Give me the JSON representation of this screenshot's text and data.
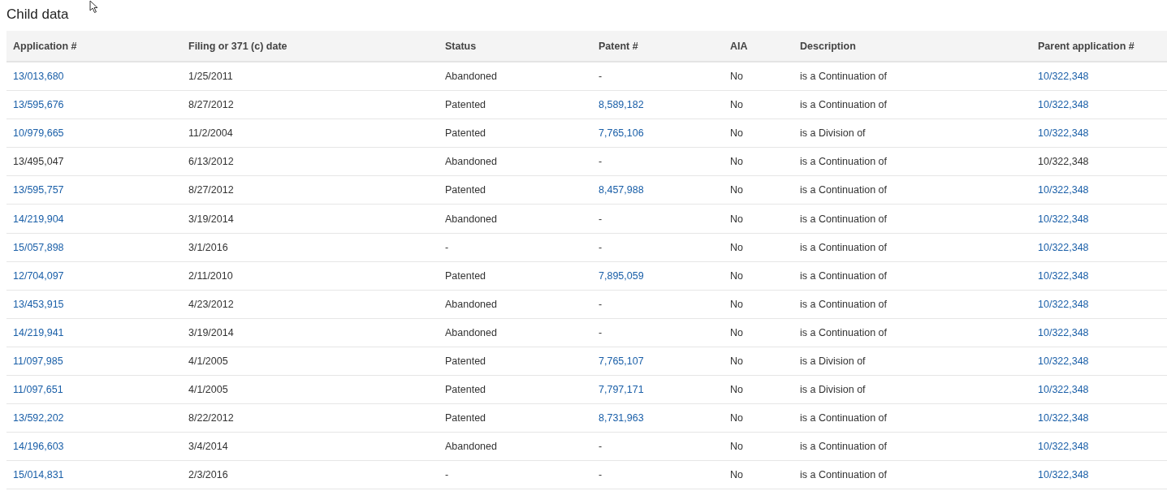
{
  "title": "Child data",
  "table": {
    "columns": [
      "Application #",
      "Filing or 371 (c) date",
      "Status",
      "Patent #",
      "AIA",
      "Description",
      "Parent application #"
    ],
    "rows": [
      {
        "application": "13/013,680",
        "date": "1/25/2011",
        "status": "Abandoned",
        "patent": "-",
        "patent_linked": false,
        "aia": "No",
        "description": "is a Continuation of",
        "parent": "10/322,348",
        "linked": true
      },
      {
        "application": "13/595,676",
        "date": "8/27/2012",
        "status": "Patented",
        "patent": "8,589,182",
        "patent_linked": true,
        "aia": "No",
        "description": "is a Continuation of",
        "parent": "10/322,348",
        "linked": true
      },
      {
        "application": "10/979,665",
        "date": "11/2/2004",
        "status": "Patented",
        "patent": "7,765,106",
        "patent_linked": true,
        "aia": "No",
        "description": "is a Division of",
        "parent": "10/322,348",
        "linked": true
      },
      {
        "application": "13/495,047",
        "date": "6/13/2012",
        "status": "Abandoned",
        "patent": "-",
        "patent_linked": false,
        "aia": "No",
        "description": "is a Continuation of",
        "parent": "10/322,348",
        "linked": false
      },
      {
        "application": "13/595,757",
        "date": "8/27/2012",
        "status": "Patented",
        "patent": "8,457,988",
        "patent_linked": true,
        "aia": "No",
        "description": "is a Continuation of",
        "parent": "10/322,348",
        "linked": true
      },
      {
        "application": "14/219,904",
        "date": "3/19/2014",
        "status": "Abandoned",
        "patent": "-",
        "patent_linked": false,
        "aia": "No",
        "description": "is a Continuation of",
        "parent": "10/322,348",
        "linked": true
      },
      {
        "application": "15/057,898",
        "date": "3/1/2016",
        "status": "-",
        "patent": "-",
        "patent_linked": false,
        "aia": "No",
        "description": "is a Continuation of",
        "parent": "10/322,348",
        "linked": true
      },
      {
        "application": "12/704,097",
        "date": "2/11/2010",
        "status": "Patented",
        "patent": "7,895,059",
        "patent_linked": true,
        "aia": "No",
        "description": "is a Continuation of",
        "parent": "10/322,348",
        "linked": true
      },
      {
        "application": "13/453,915",
        "date": "4/23/2012",
        "status": "Abandoned",
        "patent": "-",
        "patent_linked": false,
        "aia": "No",
        "description": "is a Continuation of",
        "parent": "10/322,348",
        "linked": true
      },
      {
        "application": "14/219,941",
        "date": "3/19/2014",
        "status": "Abandoned",
        "patent": "-",
        "patent_linked": false,
        "aia": "No",
        "description": "is a Continuation of",
        "parent": "10/322,348",
        "linked": true
      },
      {
        "application": "11/097,985",
        "date": "4/1/2005",
        "status": "Patented",
        "patent": "7,765,107",
        "patent_linked": true,
        "aia": "No",
        "description": "is a Division of",
        "parent": "10/322,348",
        "linked": true
      },
      {
        "application": "11/097,651",
        "date": "4/1/2005",
        "status": "Patented",
        "patent": "7,797,171",
        "patent_linked": true,
        "aia": "No",
        "description": "is a Division of",
        "parent": "10/322,348",
        "linked": true
      },
      {
        "application": "13/592,202",
        "date": "8/22/2012",
        "status": "Patented",
        "patent": "8,731,963",
        "patent_linked": true,
        "aia": "No",
        "description": "is a Continuation of",
        "parent": "10/322,348",
        "linked": true
      },
      {
        "application": "14/196,603",
        "date": "3/4/2014",
        "status": "Abandoned",
        "patent": "-",
        "patent_linked": false,
        "aia": "No",
        "description": "is a Continuation of",
        "parent": "10/322,348",
        "linked": true
      },
      {
        "application": "15/014,831",
        "date": "2/3/2016",
        "status": "-",
        "patent": "-",
        "patent_linked": false,
        "aia": "No",
        "description": "is a Continuation of",
        "parent": "10/322,348",
        "linked": true
      }
    ]
  }
}
